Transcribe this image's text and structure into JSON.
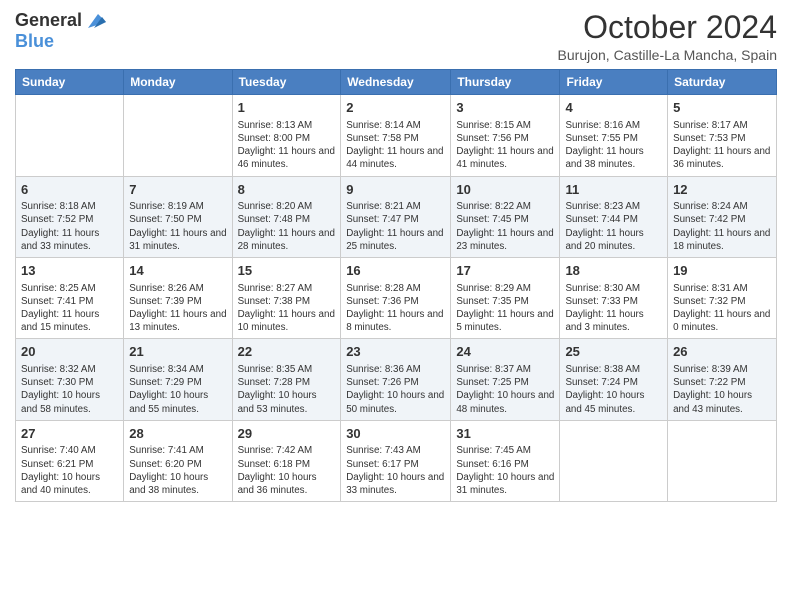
{
  "header": {
    "logo_general": "General",
    "logo_blue": "Blue",
    "month_title": "October 2024",
    "location": "Burujon, Castille-La Mancha, Spain"
  },
  "days_of_week": [
    "Sunday",
    "Monday",
    "Tuesday",
    "Wednesday",
    "Thursday",
    "Friday",
    "Saturday"
  ],
  "weeks": [
    [
      {
        "day": "",
        "info": ""
      },
      {
        "day": "",
        "info": ""
      },
      {
        "day": "1",
        "info": "Sunrise: 8:13 AM\nSunset: 8:00 PM\nDaylight: 11 hours and 46 minutes."
      },
      {
        "day": "2",
        "info": "Sunrise: 8:14 AM\nSunset: 7:58 PM\nDaylight: 11 hours and 44 minutes."
      },
      {
        "day": "3",
        "info": "Sunrise: 8:15 AM\nSunset: 7:56 PM\nDaylight: 11 hours and 41 minutes."
      },
      {
        "day": "4",
        "info": "Sunrise: 8:16 AM\nSunset: 7:55 PM\nDaylight: 11 hours and 38 minutes."
      },
      {
        "day": "5",
        "info": "Sunrise: 8:17 AM\nSunset: 7:53 PM\nDaylight: 11 hours and 36 minutes."
      }
    ],
    [
      {
        "day": "6",
        "info": "Sunrise: 8:18 AM\nSunset: 7:52 PM\nDaylight: 11 hours and 33 minutes."
      },
      {
        "day": "7",
        "info": "Sunrise: 8:19 AM\nSunset: 7:50 PM\nDaylight: 11 hours and 31 minutes."
      },
      {
        "day": "8",
        "info": "Sunrise: 8:20 AM\nSunset: 7:48 PM\nDaylight: 11 hours and 28 minutes."
      },
      {
        "day": "9",
        "info": "Sunrise: 8:21 AM\nSunset: 7:47 PM\nDaylight: 11 hours and 25 minutes."
      },
      {
        "day": "10",
        "info": "Sunrise: 8:22 AM\nSunset: 7:45 PM\nDaylight: 11 hours and 23 minutes."
      },
      {
        "day": "11",
        "info": "Sunrise: 8:23 AM\nSunset: 7:44 PM\nDaylight: 11 hours and 20 minutes."
      },
      {
        "day": "12",
        "info": "Sunrise: 8:24 AM\nSunset: 7:42 PM\nDaylight: 11 hours and 18 minutes."
      }
    ],
    [
      {
        "day": "13",
        "info": "Sunrise: 8:25 AM\nSunset: 7:41 PM\nDaylight: 11 hours and 15 minutes."
      },
      {
        "day": "14",
        "info": "Sunrise: 8:26 AM\nSunset: 7:39 PM\nDaylight: 11 hours and 13 minutes."
      },
      {
        "day": "15",
        "info": "Sunrise: 8:27 AM\nSunset: 7:38 PM\nDaylight: 11 hours and 10 minutes."
      },
      {
        "day": "16",
        "info": "Sunrise: 8:28 AM\nSunset: 7:36 PM\nDaylight: 11 hours and 8 minutes."
      },
      {
        "day": "17",
        "info": "Sunrise: 8:29 AM\nSunset: 7:35 PM\nDaylight: 11 hours and 5 minutes."
      },
      {
        "day": "18",
        "info": "Sunrise: 8:30 AM\nSunset: 7:33 PM\nDaylight: 11 hours and 3 minutes."
      },
      {
        "day": "19",
        "info": "Sunrise: 8:31 AM\nSunset: 7:32 PM\nDaylight: 11 hours and 0 minutes."
      }
    ],
    [
      {
        "day": "20",
        "info": "Sunrise: 8:32 AM\nSunset: 7:30 PM\nDaylight: 10 hours and 58 minutes."
      },
      {
        "day": "21",
        "info": "Sunrise: 8:34 AM\nSunset: 7:29 PM\nDaylight: 10 hours and 55 minutes."
      },
      {
        "day": "22",
        "info": "Sunrise: 8:35 AM\nSunset: 7:28 PM\nDaylight: 10 hours and 53 minutes."
      },
      {
        "day": "23",
        "info": "Sunrise: 8:36 AM\nSunset: 7:26 PM\nDaylight: 10 hours and 50 minutes."
      },
      {
        "day": "24",
        "info": "Sunrise: 8:37 AM\nSunset: 7:25 PM\nDaylight: 10 hours and 48 minutes."
      },
      {
        "day": "25",
        "info": "Sunrise: 8:38 AM\nSunset: 7:24 PM\nDaylight: 10 hours and 45 minutes."
      },
      {
        "day": "26",
        "info": "Sunrise: 8:39 AM\nSunset: 7:22 PM\nDaylight: 10 hours and 43 minutes."
      }
    ],
    [
      {
        "day": "27",
        "info": "Sunrise: 7:40 AM\nSunset: 6:21 PM\nDaylight: 10 hours and 40 minutes."
      },
      {
        "day": "28",
        "info": "Sunrise: 7:41 AM\nSunset: 6:20 PM\nDaylight: 10 hours and 38 minutes."
      },
      {
        "day": "29",
        "info": "Sunrise: 7:42 AM\nSunset: 6:18 PM\nDaylight: 10 hours and 36 minutes."
      },
      {
        "day": "30",
        "info": "Sunrise: 7:43 AM\nSunset: 6:17 PM\nDaylight: 10 hours and 33 minutes."
      },
      {
        "day": "31",
        "info": "Sunrise: 7:45 AM\nSunset: 6:16 PM\nDaylight: 10 hours and 31 minutes."
      },
      {
        "day": "",
        "info": ""
      },
      {
        "day": "",
        "info": ""
      }
    ]
  ]
}
